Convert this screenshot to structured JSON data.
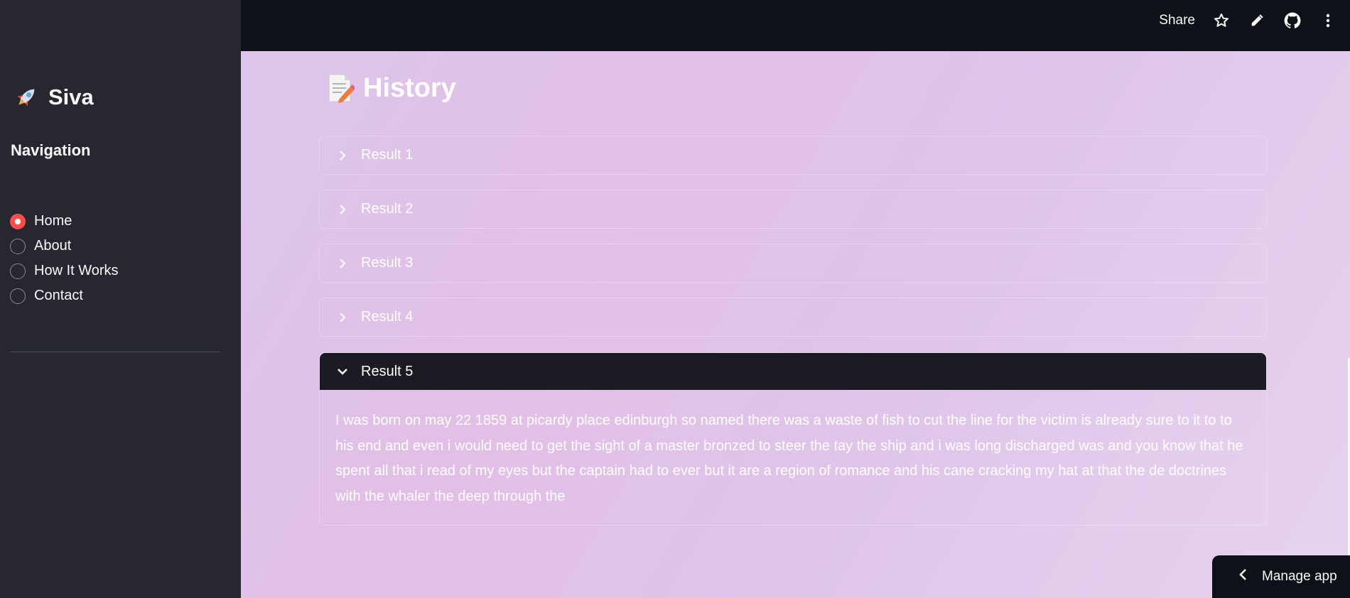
{
  "sidebar": {
    "app_name": "Siva",
    "nav_heading": "Navigation",
    "nav_items": [
      {
        "label": "Home",
        "selected": true
      },
      {
        "label": "About",
        "selected": false
      },
      {
        "label": "How It Works",
        "selected": false
      },
      {
        "label": "Contact",
        "selected": false
      }
    ]
  },
  "header": {
    "share_label": "Share",
    "icons": [
      "star-icon",
      "pencil-icon",
      "github-icon",
      "more-vertical-icon"
    ]
  },
  "main": {
    "page_title": "History",
    "results": [
      {
        "label": "Result 1",
        "expanded": false
      },
      {
        "label": "Result 2",
        "expanded": false
      },
      {
        "label": "Result 3",
        "expanded": false
      },
      {
        "label": "Result 4",
        "expanded": false
      },
      {
        "label": "Result 5",
        "expanded": true,
        "content": "I was born on may 22 1859 at picardy place edinburgh so named there was a waste of fish to cut the line for the victim is already sure to it to to his end and even i would need to get the sight of a master bronzed to steer the tay the ship and i was long discharged was and you know that he spent all that i read of my eyes but the captain had to ever but it are a region of romance and his cane cracking my hat at that the de doctrines with the whaler the deep through the"
      }
    ]
  },
  "manage_app_label": "Manage app",
  "colors": {
    "accent": "#ff4b4b",
    "sidebar_bg": "#262730",
    "header_bg": "#0e1117",
    "expander_open_bg": "#1b1c23"
  }
}
